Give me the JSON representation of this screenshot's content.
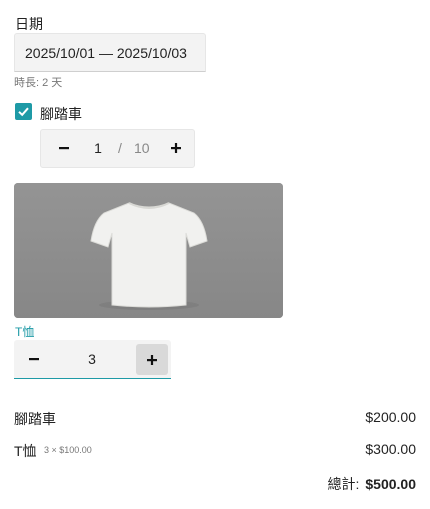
{
  "date": {
    "label": "日期",
    "range": "2025/10/01 — 2025/10/03",
    "duration": "時長: 2 天"
  },
  "bike": {
    "checkbox_checked": true,
    "label": "腳踏車",
    "quantity": "1",
    "separator": "/",
    "max": "10",
    "minus_icon": "minus-icon",
    "plus_icon": "plus-icon"
  },
  "tshirt": {
    "image_icon": "tshirt-image",
    "label": "T恤",
    "quantity": "3"
  },
  "summary": {
    "items": [
      {
        "name": "腳踏車",
        "detail": "",
        "price": "$200.00"
      },
      {
        "name": "T恤",
        "detail": "3 × $100.00",
        "price": "$300.00"
      }
    ],
    "total_label": "總計:",
    "total_value": "$500.00"
  },
  "colors": {
    "accent": "#1e9aa6",
    "field_bg": "#f3f3f3",
    "image_bg": "#8d8d8d"
  }
}
